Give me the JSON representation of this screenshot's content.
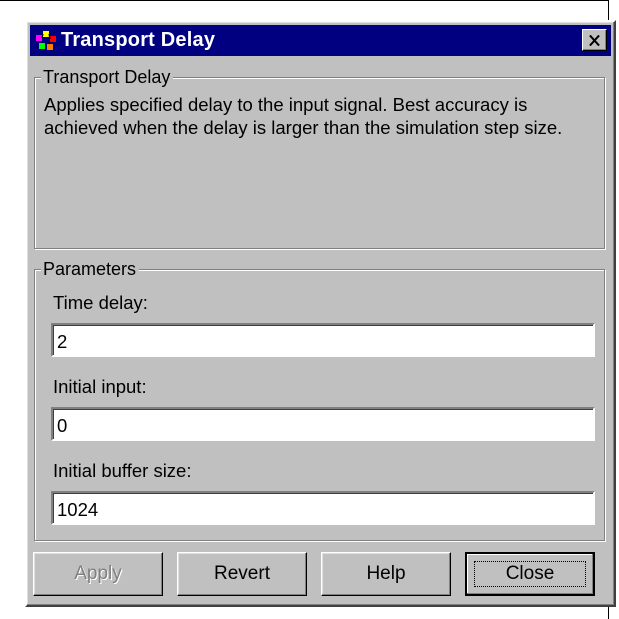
{
  "window": {
    "title": "Transport Delay",
    "icon": "simulink-block-icon"
  },
  "description_group": {
    "legend": "Transport Delay",
    "text": "Applies specified delay to the input signal.  Best accuracy is achieved when the delay is larger than the simulation step size."
  },
  "parameters_group": {
    "legend": "Parameters",
    "fields": [
      {
        "label": "Time delay:",
        "value": "2"
      },
      {
        "label": "Initial input:",
        "value": "0"
      },
      {
        "label": "Initial buffer size:",
        "value": "1024"
      }
    ]
  },
  "buttons": {
    "apply": "Apply",
    "revert": "Revert",
    "help": "Help",
    "close": "Close"
  },
  "colors": {
    "titlebar": "#000080",
    "dialog_face": "#c0c0c0",
    "disabled_text": "#808080"
  }
}
